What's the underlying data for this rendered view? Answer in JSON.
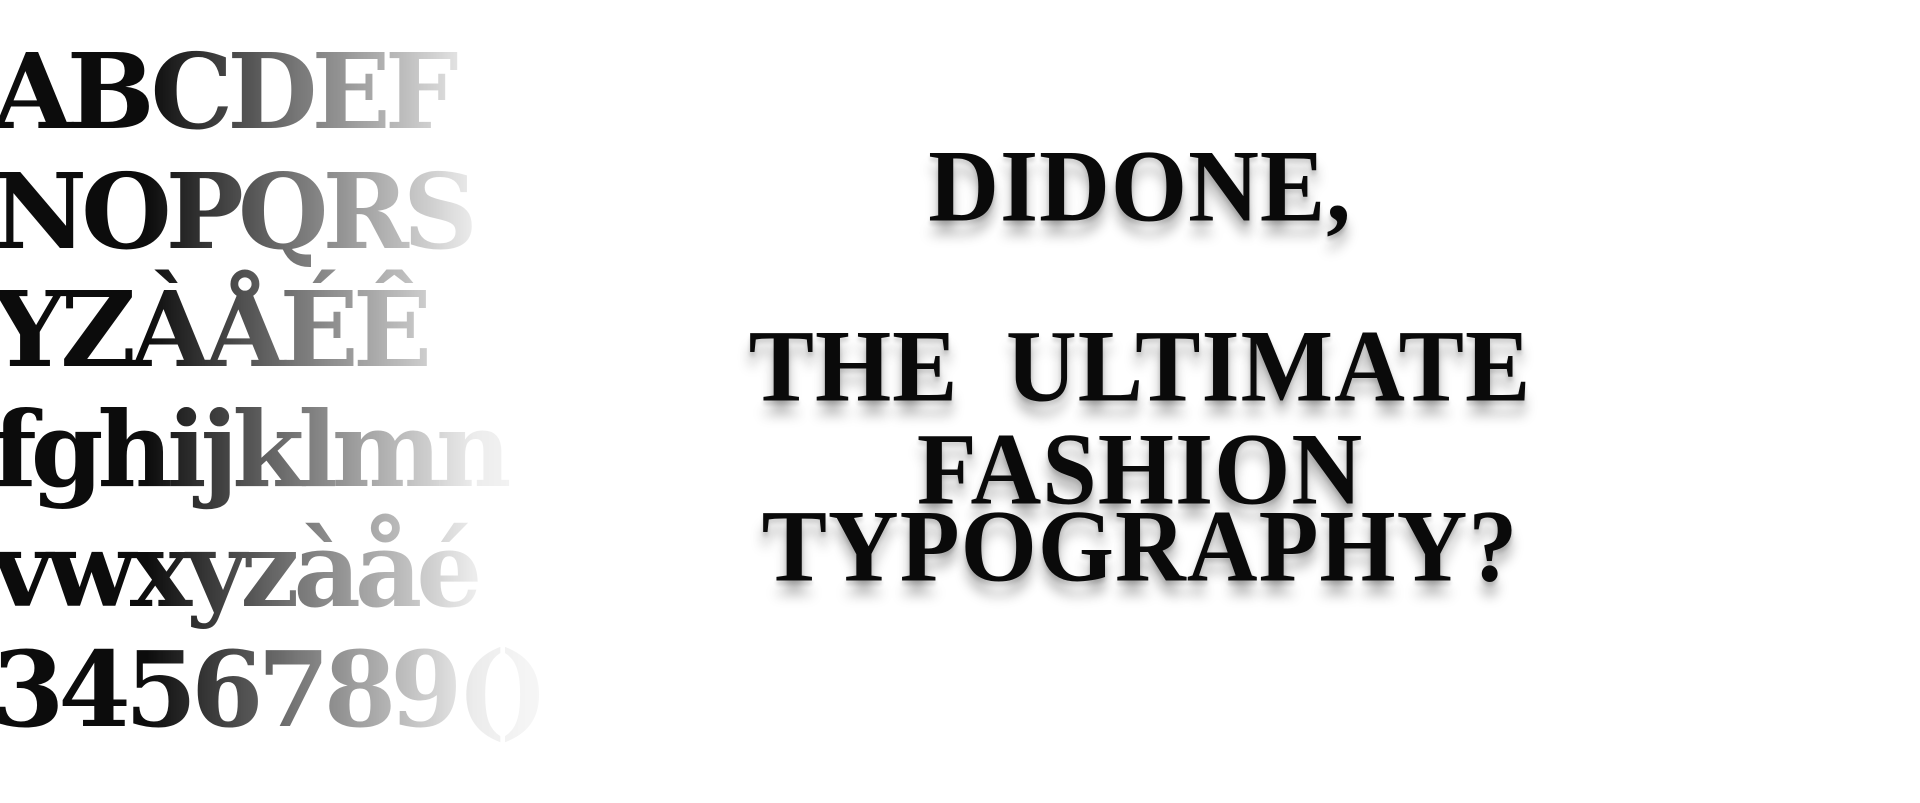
{
  "specimen": {
    "lines": [
      "ABCDEF",
      "NOPQRS",
      "YZÀÅÉÊ",
      "fghijklmn",
      "vwxyzàåé",
      "3456789()"
    ]
  },
  "headline": {
    "line1": "DIDONE,",
    "line2": "THE ULTIMATE FASHION",
    "line3": "TYPOGRAPHY?"
  }
}
